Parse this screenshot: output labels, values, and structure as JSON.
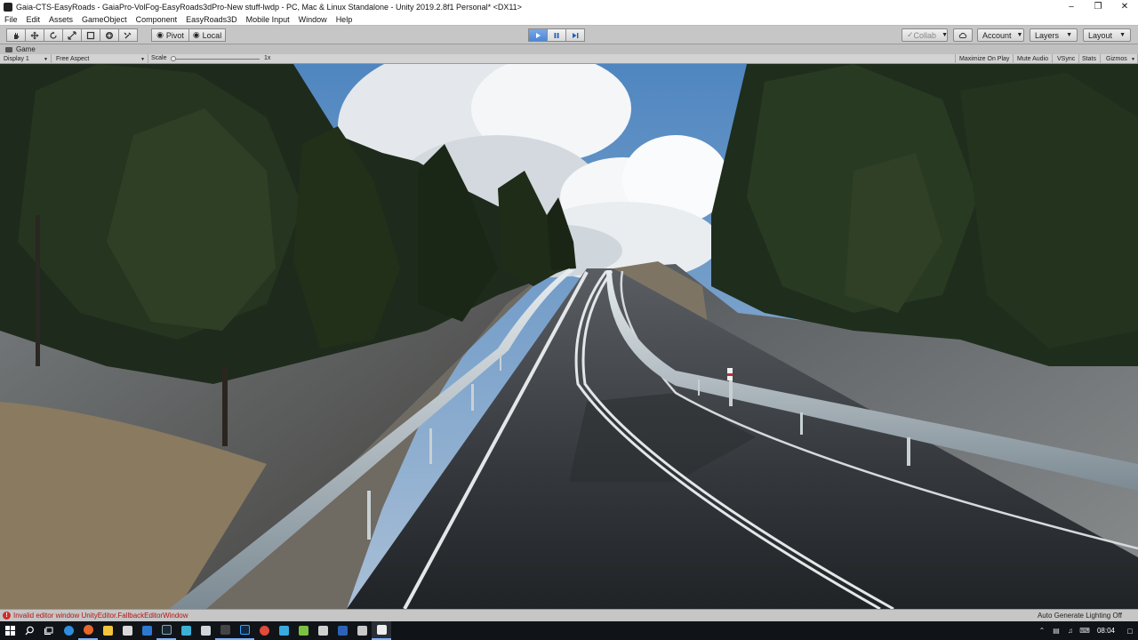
{
  "window": {
    "title": "Gaia-CTS-EasyRoads - GaiaPro-VolFog-EasyRoads3dPro-New stuff-lwdp - PC, Mac & Linux Standalone - Unity 2019.2.8f1 Personal* <DX11>",
    "minimize_icon": "minimize-icon",
    "maximize_icon": "restore-icon",
    "close_icon": "close-icon"
  },
  "menubar": {
    "items": [
      "File",
      "Edit",
      "Assets",
      "GameObject",
      "Component",
      "EasyRoads3D",
      "Mobile Input",
      "Window",
      "Help"
    ]
  },
  "toolbar": {
    "pivot_label": "Pivot",
    "local_label": "Local",
    "collab_label": "Collab",
    "account_label": "Account",
    "layers_label": "Layers",
    "layout_label": "Layout"
  },
  "game_view": {
    "tab_label": "Game",
    "display_label": "Display 1",
    "aspect_label": "Free Aspect",
    "scale_label": "Scale",
    "scale_value": "1x",
    "maximize_label": "Maximize On Play",
    "mute_label": "Mute Audio",
    "vsync_label": "VSync",
    "stats_label": "Stats",
    "gizmos_label": "Gizmos"
  },
  "statusbar": {
    "error_message": "Invalid editor window UnityEditor.FallbackEditorWindow",
    "right_message": "Auto Generate Lighting Off"
  },
  "taskbar": {
    "clock": "08:04"
  },
  "colors": {
    "play_active": "#4c86d8",
    "error": "#b41414",
    "taskbar": "#101418"
  }
}
